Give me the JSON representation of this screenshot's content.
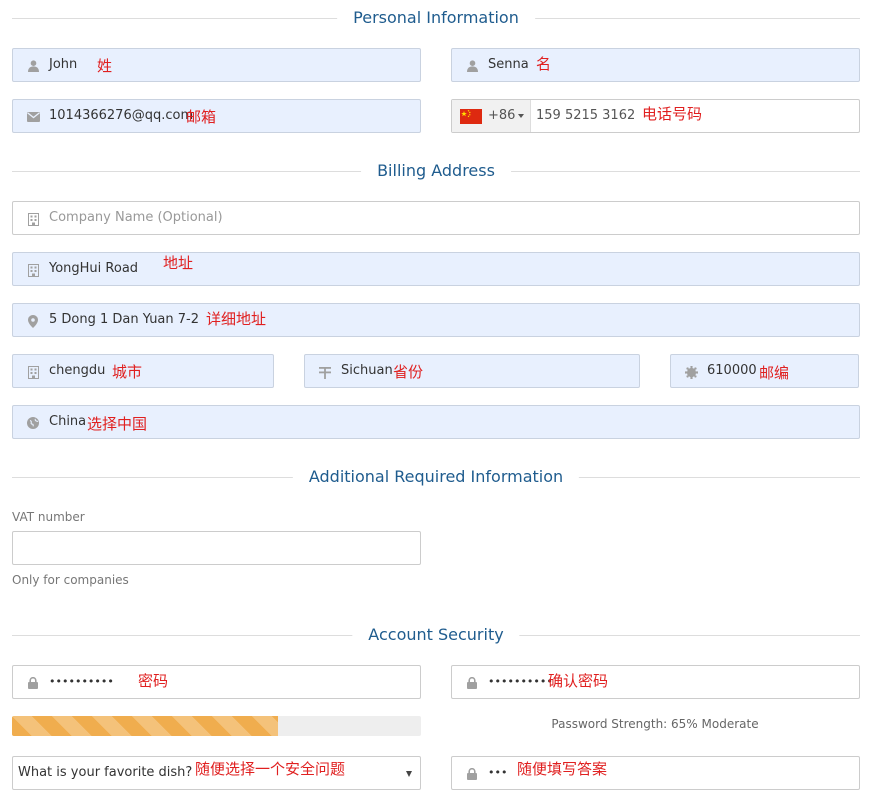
{
  "sections": {
    "personal": "Personal Information",
    "billing": "Billing Address",
    "additional": "Additional Required Information",
    "security": "Account Security"
  },
  "personal": {
    "first_name": "John",
    "first_name_note": "姓",
    "last_name": "Senna",
    "last_name_note": "名",
    "email": "1014366276@qq.com",
    "email_note": "邮箱",
    "phone_code": "+86",
    "phone": "159 5215 3162",
    "phone_note": "电话号码"
  },
  "billing": {
    "company_placeholder": "Company Name (Optional)",
    "address1": "YongHui Road",
    "address1_note": "地址",
    "address2": "5 Dong 1 Dan Yuan 7-2",
    "address2_note": "详细地址",
    "city": "chengdu",
    "city_note": "城市",
    "state": "Sichuan",
    "state_note": "省份",
    "postcode": "610000",
    "postcode_note": "邮编",
    "country": "China",
    "country_note": "选择中国"
  },
  "additional": {
    "vat_label": "VAT number",
    "vat_value": "",
    "vat_help": "Only for companies"
  },
  "security": {
    "password_mask": "••••••••••",
    "password_note": "密码",
    "confirm_mask": "••••••••••",
    "confirm_note": "确认密码",
    "strength_percent": 65,
    "strength_text": "Password Strength: 65% Moderate",
    "question": "What is your favorite dish?",
    "question_note": "随便选择一个安全问题",
    "answer_mask": "•••",
    "answer_note": "随便填写答案"
  },
  "icons": {
    "person": "user-icon",
    "email": "envelope-icon",
    "flag": "china-flag-icon",
    "building": "building-icon",
    "pin": "map-marker-icon",
    "state": "state-icon",
    "postcode": "certificate-icon",
    "globe": "globe-icon",
    "lock": "lock-icon"
  },
  "colors": {
    "section_title": "#1f5c8e",
    "annotation": "#e02020",
    "autofill_bg": "#e8f0fe",
    "progress": "#f0ad4e"
  }
}
